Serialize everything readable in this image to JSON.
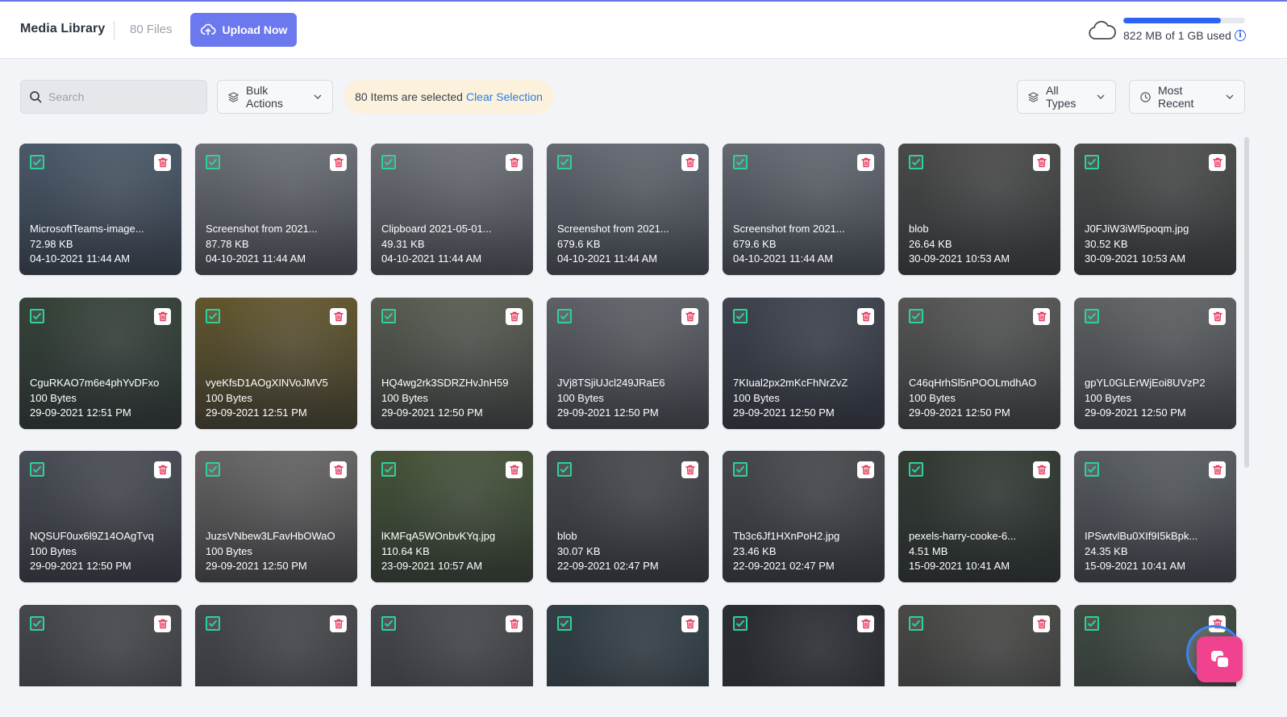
{
  "header": {
    "title": "Media Library",
    "file_count": "80 Files",
    "upload_label": "Upload Now",
    "storage_text": "822 MB of 1 GB used",
    "storage_fraction": 0.803,
    "info_glyph": "i"
  },
  "toolbar": {
    "search_placeholder": "Search",
    "bulk_actions": "Bulk Actions",
    "selection_text": "80 Items are selected",
    "clear_selection": "Clear Selection",
    "type_filter": "All Types",
    "sort": "Most Recent"
  },
  "colors": {
    "accent": "#6b78ee",
    "check": "#2ed19a",
    "trash": "#e8355a",
    "storage_bar": "#2b64f0",
    "chat": "#f0428e"
  },
  "items": [
    {
      "name": "MicrosoftTeams-image...",
      "size": "72.98 KB",
      "date": "04-10-2021 11:44 AM",
      "thumb": "#5c6f84"
    },
    {
      "name": "Screenshot from 2021...",
      "size": "87.78 KB",
      "date": "04-10-2021 11:44 AM",
      "thumb": "#8a8e96"
    },
    {
      "name": "Clipboard 2021-05-01...",
      "size": "49.31 KB",
      "date": "04-10-2021 11:44 AM",
      "thumb": "#8d9098"
    },
    {
      "name": "Screenshot from 2021...",
      "size": "679.6 KB",
      "date": "04-10-2021 11:44 AM",
      "thumb": "#7f858f"
    },
    {
      "name": "Screenshot from 2021...",
      "size": "679.6 KB",
      "date": "04-10-2021 11:44 AM",
      "thumb": "#7f858f"
    },
    {
      "name": "blob",
      "size": "26.64 KB",
      "date": "30-09-2021 10:53 AM",
      "thumb": "#5a5a55"
    },
    {
      "name": "J0FJiW3iWl5poqm.jpg",
      "size": "30.52 KB",
      "date": "30-09-2021 10:53 AM",
      "thumb": "#5d5e59"
    },
    {
      "name": "CguRKAO7m6e4phYvDFxo",
      "size": "100 Bytes",
      "date": "29-09-2021 12:51 PM",
      "thumb": "#3e4f3e"
    },
    {
      "name": "vyeKfsD1AOgXINVoJMV5",
      "size": "100 Bytes",
      "date": "29-09-2021 12:51 PM",
      "thumb": "#7d6b2e"
    },
    {
      "name": "HQ4wg2rk3SDRZHvJnH59",
      "size": "100 Bytes",
      "date": "29-09-2021 12:50 PM",
      "thumb": "#6e7360"
    },
    {
      "name": "JVj8TSjiUJcl249JRaE6",
      "size": "100 Bytes",
      "date": "29-09-2021 12:50 PM",
      "thumb": "#777a80"
    },
    {
      "name": "7KIual2px2mKcFhNrZvZ",
      "size": "100 Bytes",
      "date": "29-09-2021 12:50 PM",
      "thumb": "#4a4f5c"
    },
    {
      "name": "C46qHrhSl5nPOOLmdhAO",
      "size": "100 Bytes",
      "date": "29-09-2021 12:50 PM",
      "thumb": "#6b6b66"
    },
    {
      "name": "gpYL0GLErWjEoi8UVzP2",
      "size": "100 Bytes",
      "date": "29-09-2021 12:50 PM",
      "thumb": "#797b7d"
    },
    {
      "name": "NQSUF0ux6l9Z14OAgTvq",
      "size": "100 Bytes",
      "date": "29-09-2021 12:50 PM",
      "thumb": "#5a5d66"
    },
    {
      "name": "JuzsVNbew3LFavHbOWaO",
      "size": "100 Bytes",
      "date": "29-09-2021 12:50 PM",
      "thumb": "#84807c"
    },
    {
      "name": "lKMFqA5WOnbvKYq.jpg",
      "size": "110.64 KB",
      "date": "23-09-2021 10:57 AM",
      "thumb": "#55673d"
    },
    {
      "name": "blob",
      "size": "30.07 KB",
      "date": "22-09-2021 02:47 PM",
      "thumb": "#55575a"
    },
    {
      "name": "Tb3c6Jf1HXnPoH2.jpg",
      "size": "23.46 KB",
      "date": "22-09-2021 02:47 PM",
      "thumb": "#55575a"
    },
    {
      "name": "pexels-harry-cooke-6...",
      "size": "4.51 MB",
      "date": "15-09-2021 10:41 AM",
      "thumb": "#3a4436"
    },
    {
      "name": "IPSwtvlBu0XIf9I5kBpk...",
      "size": "24.35 KB",
      "date": "15-09-2021 10:41 AM",
      "thumb": "#6f7479"
    },
    {
      "name": "",
      "size": "",
      "date": "",
      "thumb": "#55575a"
    },
    {
      "name": "",
      "size": "",
      "date": "",
      "thumb": "#55575a"
    },
    {
      "name": "",
      "size": "",
      "date": "",
      "thumb": "#55575a"
    },
    {
      "name": "",
      "size": "",
      "date": "",
      "thumb": "#3a4a52"
    },
    {
      "name": "",
      "size": "",
      "date": "",
      "thumb": "#2e3035"
    },
    {
      "name": "",
      "size": "",
      "date": "",
      "thumb": "#5a5850"
    },
    {
      "name": "",
      "size": "",
      "date": "",
      "thumb": "#4d5a4a"
    }
  ]
}
